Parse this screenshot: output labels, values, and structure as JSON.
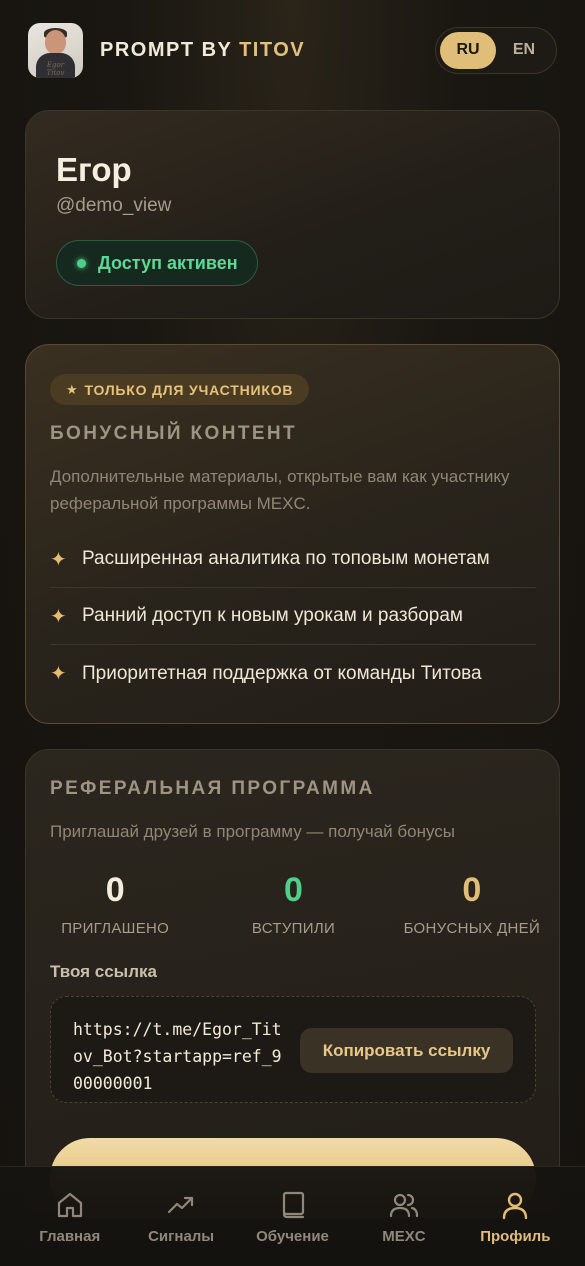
{
  "header": {
    "brand_prefix": "PROMPT BY ",
    "brand_accent": "TITOV",
    "avatar_signature": "Egor Titov",
    "lang_options": [
      "RU",
      "EN"
    ],
    "lang_selected": "RU"
  },
  "profile": {
    "name": "Егор",
    "handle": "@demo_view",
    "status": "Доступ активен"
  },
  "bonus": {
    "tag_star": "★",
    "tag": "ТОЛЬКО ДЛЯ УЧАСТНИКОВ",
    "title": "БОНУСНЫЙ КОНТЕНТ",
    "description": "Дополнительные материалы, открытые вам как участнику реферальной программы MEXC.",
    "items": [
      {
        "icon": "sparkle-icon",
        "label": "Расширенная аналитика по топовым монетам"
      },
      {
        "icon": "sparkle-icon",
        "label": "Ранний доступ к новым урокам и разборам"
      },
      {
        "icon": "sparkle-icon",
        "label": "Приоритетная поддержка от команды Титова"
      }
    ]
  },
  "referral": {
    "title": "РЕФЕРАЛЬНАЯ ПРОГРАММА",
    "description": "Приглашай друзей в программу — получай бонусы",
    "stats": [
      {
        "value": "0",
        "label": "ПРИГЛАШЕНО"
      },
      {
        "value": "0",
        "label": "ВСТУПИЛИ"
      },
      {
        "value": "0",
        "label": "БОНУСНЫХ ДНЕЙ"
      }
    ],
    "link_label": "Твоя ссылка",
    "link": "https://t.me/Egor_Titov_Bot?startapp=ref_900000001",
    "copy_button": "Копировать ссылку"
  },
  "nav": {
    "items": [
      {
        "label": "Главная",
        "icon": "home-icon",
        "active": false
      },
      {
        "label": "Сигналы",
        "icon": "trend-icon",
        "active": false
      },
      {
        "label": "Обучение",
        "icon": "book-icon",
        "active": false
      },
      {
        "label": "MEXC",
        "icon": "users-icon",
        "active": false
      },
      {
        "label": "Профиль",
        "icon": "profile-icon",
        "active": true
      }
    ]
  },
  "colors": {
    "accent_gold": "#e0bd79",
    "success_green": "#4fd08a",
    "background": "#1a1712"
  }
}
